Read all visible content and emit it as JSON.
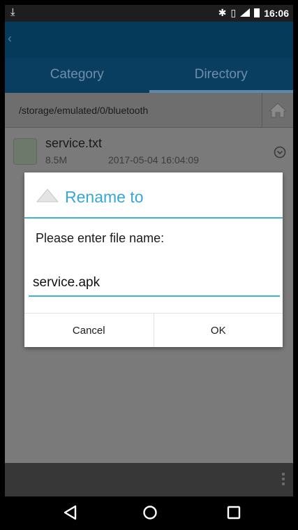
{
  "status_bar": {
    "time": "16:06",
    "icons": [
      "download-icon",
      "bluetooth-icon",
      "vibrate-icon",
      "signal-icon",
      "battery-icon"
    ]
  },
  "tabs": [
    {
      "label": "Category",
      "active": false
    },
    {
      "label": "Directory",
      "active": true
    }
  ],
  "path": "/storage/emulated/0/bluetooth",
  "file": {
    "name": "service.txt",
    "size": "8.5M",
    "date": "2017-05-04 16:04:09"
  },
  "dialog": {
    "title": "Rename to",
    "prompt": "Please enter file name:",
    "input_value": "service.apk",
    "cancel_label": "Cancel",
    "ok_label": "OK"
  },
  "colors": {
    "accent": "#3fb2d8",
    "header": "#063a5a"
  }
}
